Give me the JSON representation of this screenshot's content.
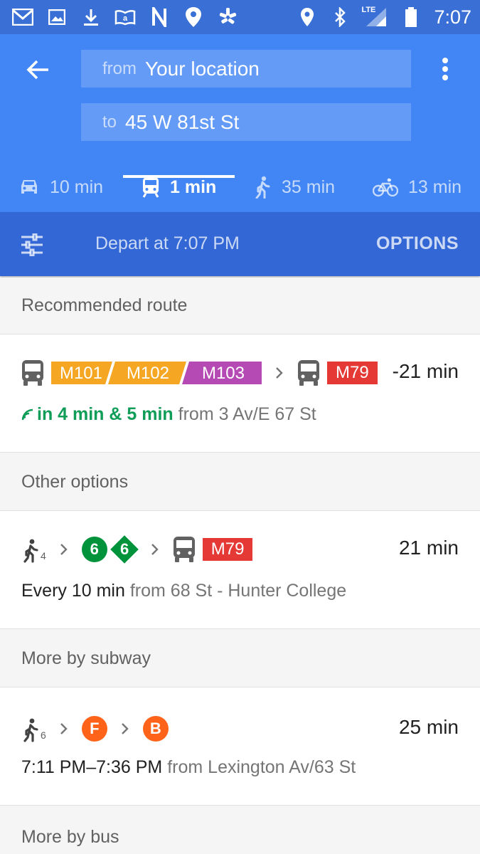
{
  "status_bar": {
    "time": "7:07",
    "network": "LTE",
    "left_icons": [
      "gmail-icon",
      "photo-icon",
      "download-icon",
      "amazon-icon",
      "n-icon",
      "maps-pin-icon",
      "yelp-icon"
    ],
    "right_icons": [
      "location-icon",
      "bluetooth-icon",
      "signal-icon",
      "battery-icon"
    ]
  },
  "header": {
    "from_prefix": "from",
    "from_value": "Your location",
    "to_prefix": "to",
    "to_value": "45 W 81st St"
  },
  "modes": [
    {
      "icon": "car-icon",
      "label": "10 min",
      "active": false
    },
    {
      "icon": "transit-icon",
      "label": "1 min",
      "active": true
    },
    {
      "icon": "walk-icon",
      "label": "35 min",
      "active": false
    },
    {
      "icon": "bike-icon",
      "label": "13 min",
      "active": false
    }
  ],
  "depart": {
    "label": "Depart at 7:07 PM",
    "options_label": "OPTIONS"
  },
  "sections": {
    "recommended": "Recommended route",
    "other": "Other options",
    "subway": "More by subway",
    "bus": "More by bus"
  },
  "routes": {
    "recommended": {
      "lines": [
        "M101",
        "M102",
        "M103"
      ],
      "transfer_line": "M79",
      "duration": "-21 min",
      "live_text": "in 4 min & 5 min",
      "from_text": "from 3 Av/E 67 St"
    },
    "other": {
      "walk_minutes": "4",
      "subway_line": "6",
      "express_line": "6",
      "bus_line": "M79",
      "duration": "21 min",
      "frequency": "Every 10 min",
      "from_text": "from 68 St - Hunter College"
    },
    "subway": {
      "walk_minutes": "6",
      "line1": "F",
      "line2": "B",
      "duration": "25 min",
      "time_range": "7:11 PM–7:36 PM",
      "from_text": "from Lexington Av/63 St"
    }
  },
  "colors": {
    "header_blue": "#4285f4",
    "depart_blue": "#3367d6",
    "status_blue": "#3a70d6",
    "line_orange": "#f5a623",
    "line_purple": "#b54ab5",
    "line_red": "#e53935",
    "subway_green": "#00933c",
    "subway_orange": "#ff6319",
    "live_green": "#0f9d58"
  }
}
